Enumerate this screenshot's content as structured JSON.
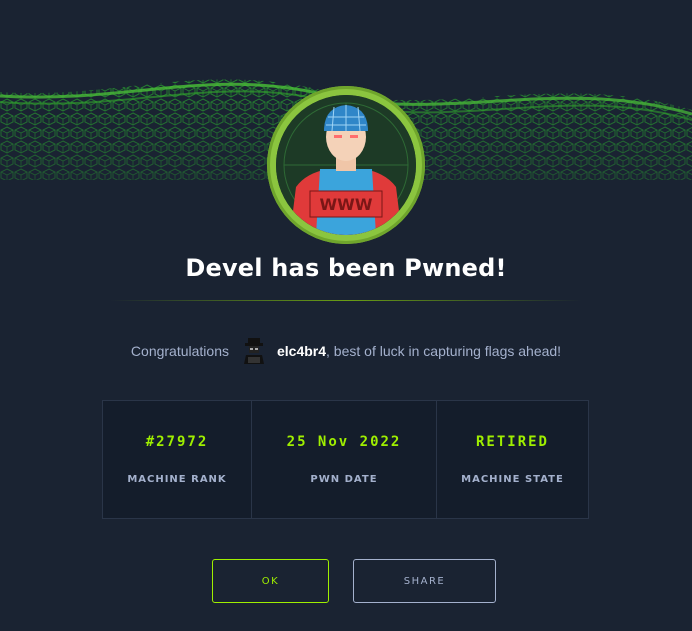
{
  "title": "Devel has been Pwned!",
  "congrats": {
    "prefix": "Congratulations",
    "username": "elc4br4",
    "suffix": ", best of luck in capturing flags ahead!"
  },
  "stats": [
    {
      "value": "#27972",
      "label": "MACHINE RANK"
    },
    {
      "value": "25 Nov 2022",
      "label": "PWN DATE"
    },
    {
      "value": "RETIRED",
      "label": "MACHINE STATE"
    }
  ],
  "buttons": {
    "ok_label": "OK",
    "share_label": "SHARE"
  },
  "avatar_text": "WWW",
  "colors": {
    "background": "#1a2332",
    "accent": "#9fef00",
    "ring": "#8bc53f",
    "text": "#a4b1cd"
  }
}
